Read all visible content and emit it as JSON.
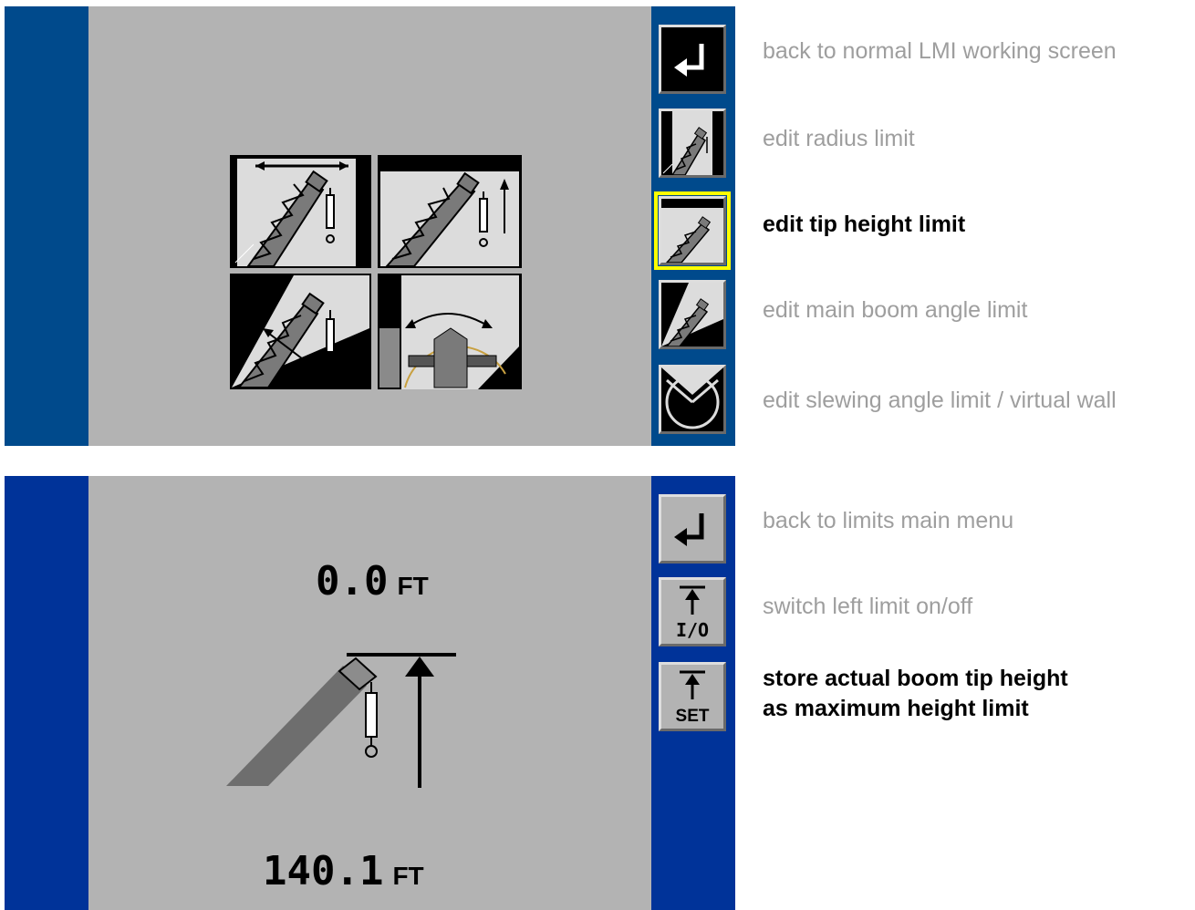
{
  "top_panel": {
    "menu_tiles": [
      {
        "name": "radius-limit-tile-icon"
      },
      {
        "name": "tip-height-limit-tile-icon"
      },
      {
        "name": "boom-angle-limit-tile-icon"
      },
      {
        "name": "slewing-limit-tile-icon"
      }
    ],
    "buttons": [
      {
        "icon": "return-arrow-icon",
        "desc": "back to normal LMI working screen"
      },
      {
        "icon": "radius-limit-icon",
        "desc": "edit radius limit"
      },
      {
        "icon": "tip-height-limit-icon",
        "desc": "edit tip height limit",
        "selected": true
      },
      {
        "icon": "boom-angle-limit-icon",
        "desc": "edit main boom angle limit"
      },
      {
        "icon": "slewing-limit-icon",
        "desc": "edit slewing angle limit / virtual wall"
      }
    ]
  },
  "bottom_panel": {
    "limit_value": "0.0",
    "limit_unit": "FT",
    "actual_value": "140.1",
    "actual_unit": "FT",
    "buttons": [
      {
        "icon": "return-arrow-icon",
        "desc": "back to limits main menu"
      },
      {
        "icon": "height-limit-icon",
        "label": "I/O",
        "desc": "switch left limit on/off"
      },
      {
        "icon": "height-limit-icon",
        "label": "SET",
        "desc_line1": "store actual boom tip height",
        "desc_line2": "as maximum height limit",
        "active": true
      }
    ]
  },
  "colors": {
    "screen_gray": "#b3b3b3",
    "top_blue": "#004a8c",
    "bottom_blue": "#003399",
    "selection": "#ffff00",
    "inactive_text": "#9e9e9e"
  }
}
